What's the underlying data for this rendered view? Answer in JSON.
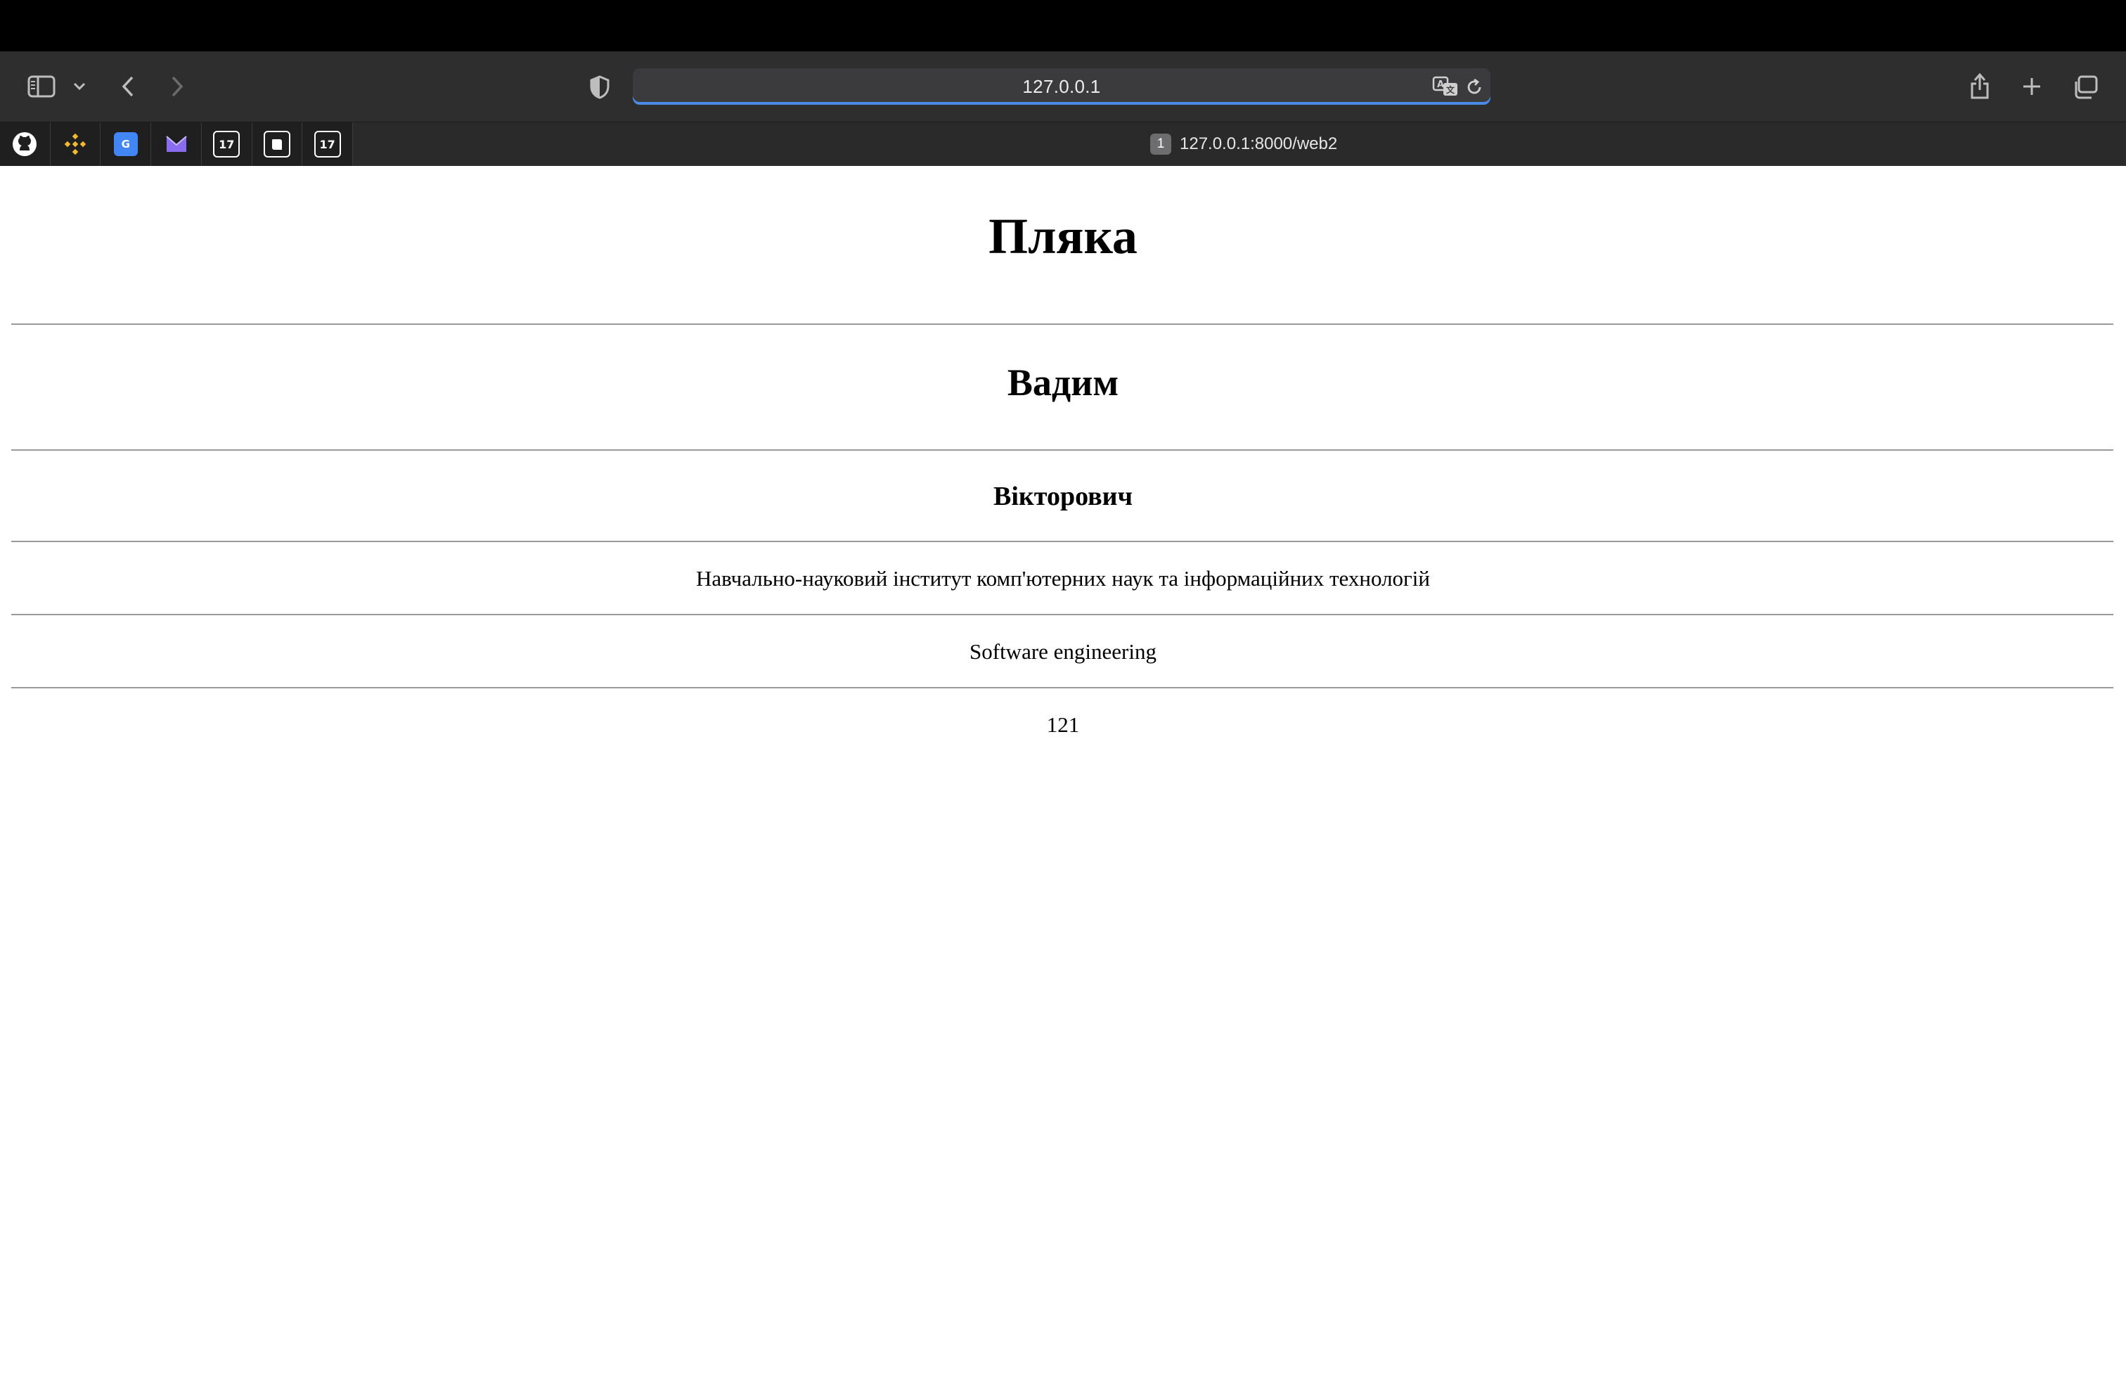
{
  "browser": {
    "address_text": "127.0.0.1",
    "tab_count": "1",
    "tab_title": "127.0.0.1:8000/web2",
    "accent_color": "#4a8be8",
    "pinned_tabs": [
      {
        "icon": "github-icon"
      },
      {
        "icon": "binance-icon"
      },
      {
        "icon": "google-translate-icon"
      },
      {
        "icon": "proton-mail-icon"
      },
      {
        "icon": "tradingview-icon"
      },
      {
        "icon": "notion-icon"
      },
      {
        "icon": "tradingview-icon"
      }
    ]
  },
  "page": {
    "surname": "Пляка",
    "first_name": "Вадим",
    "patronymic": "Вікторович",
    "institute": "Навчально-науковий інститут комп'ютерних наук та інформаційних технологій",
    "specialty": "Software engineering",
    "group": "121"
  }
}
